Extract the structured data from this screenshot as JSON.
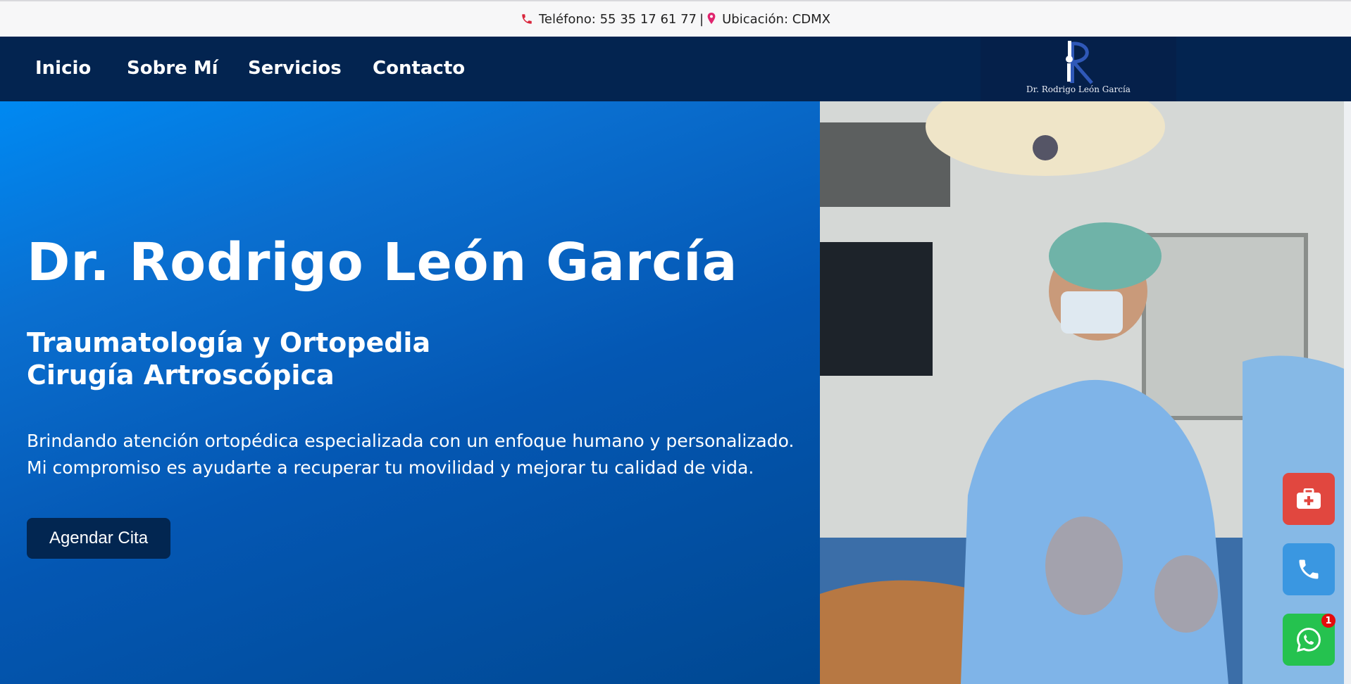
{
  "topbar": {
    "phone_text": "Teléfono: 55 35 17 61 77",
    "separator": "|",
    "location_text": "Ubicación: CDMX"
  },
  "nav": {
    "items": [
      {
        "label": "Inicio"
      },
      {
        "label": "Sobre Mí"
      },
      {
        "label": "Servicios"
      },
      {
        "label": "Contacto"
      }
    ]
  },
  "logo": {
    "text": "Dr. Rodrigo León García"
  },
  "hero": {
    "title": "Dr. Rodrigo León García",
    "subtitle_line1": "Traumatología y Ortopedia",
    "subtitle_line2": "Cirugía Artroscópica",
    "desc_line1": "Brindando atención ortopédica especializada con un enfoque humano y personalizado.",
    "desc_line2": "Mi compromiso es ayudarte a recuperar tu movilidad y mejorar tu calidad de vida.",
    "cta": "Agendar Cita"
  },
  "floating": {
    "whatsapp_badge": "1"
  },
  "icons": {
    "phone": "phone-icon",
    "location": "map-pin-icon",
    "medkit": "medical-kit-icon",
    "call": "phone-handset-icon",
    "whatsapp": "whatsapp-icon"
  },
  "colors": {
    "nav_bg": "#032450",
    "button_bg": "#022651",
    "red_fab": "#e1473f",
    "blue_fab": "#3a97e1",
    "green_fab": "#25c24f"
  }
}
